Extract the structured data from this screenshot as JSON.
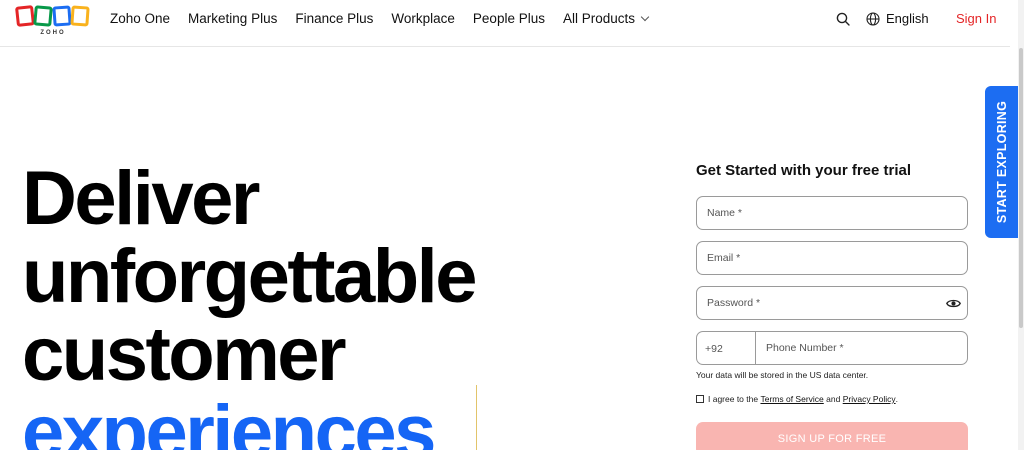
{
  "brand": {
    "logo_text": "ZOHO",
    "colors": [
      "#e42527",
      "#089949",
      "#1c6df2",
      "#f9b21d"
    ]
  },
  "nav": {
    "items": [
      {
        "label": "Zoho One"
      },
      {
        "label": "Marketing Plus"
      },
      {
        "label": "Finance Plus"
      },
      {
        "label": "Workplace"
      },
      {
        "label": "People Plus"
      },
      {
        "label": "All Products"
      }
    ],
    "search_icon": "search-icon",
    "language": "English",
    "sign_in": "Sign In"
  },
  "hero": {
    "line1": "Deliver",
    "line2": "unforgettable",
    "line3": "customer",
    "line4": "experiences",
    "accent_color": "#1565f5"
  },
  "form": {
    "title": "Get Started with your free trial",
    "name_placeholder": "Name *",
    "email_placeholder": "Email *",
    "password_placeholder": "Password *",
    "country_code": "+92",
    "phone_placeholder": "Phone Number *",
    "data_note": "Your data will be stored in the US data center.",
    "agree_prefix": "I agree to the",
    "terms": "Terms of Service",
    "and": "and",
    "privacy": "Privacy Policy",
    "period": ".",
    "submit": "SIGN UP FOR FREE"
  },
  "side_tab": {
    "label": "START EXPLORING",
    "color": "#1c6df2"
  }
}
